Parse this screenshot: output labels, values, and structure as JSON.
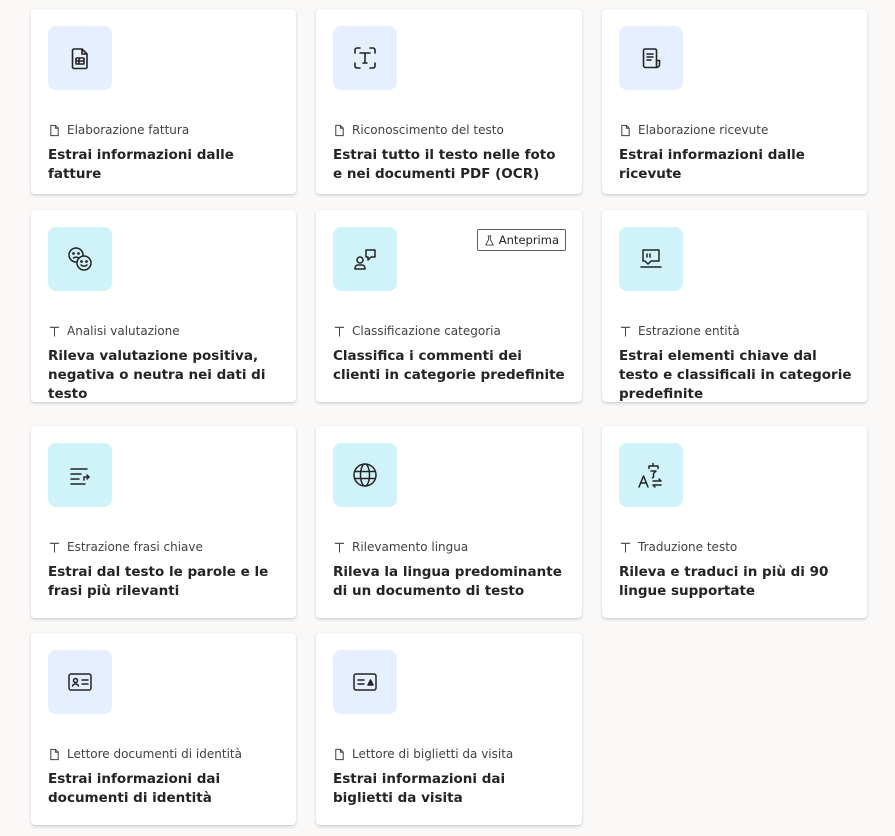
{
  "cards": [
    {
      "category": "Elaborazione fattura",
      "description": "Estrai informazioni dalle fatture",
      "icon": "invoice-icon",
      "type": "document"
    },
    {
      "category": "Riconoscimento del testo",
      "description": "Estrai tutto il testo nelle foto e nei documenti PDF (OCR)",
      "icon": "text-scan-icon",
      "type": "document"
    },
    {
      "category": "Elaborazione ricevute",
      "description": "Estrai informazioni dalle ricevute",
      "icon": "receipt-icon",
      "type": "document"
    },
    {
      "category": "Analisi valutazione",
      "description": "Rileva valutazione positiva, negativa o neutra nei dati di testo",
      "icon": "sentiment-icon",
      "type": "text"
    },
    {
      "category": "Classificazione categoria",
      "description": "Classifica i commenti dei clienti in categorie predefinite",
      "icon": "person-feedback-icon",
      "type": "text",
      "badge": "Anteprima"
    },
    {
      "category": "Estrazione entità",
      "description": "Estrai elementi chiave dal testo e classificali in categorie predefinite",
      "icon": "entity-extraction-icon",
      "type": "text"
    },
    {
      "category": "Estrazione frasi chiave",
      "description": "Estrai dal testo le parole e le frasi più rilevanti",
      "icon": "key-phrase-icon",
      "type": "text"
    },
    {
      "category": "Rilevamento lingua",
      "description": "Rileva la lingua predominante di un documento di testo",
      "icon": "globe-icon",
      "type": "text"
    },
    {
      "category": "Traduzione testo",
      "description": "Rileva e traduci in più di 90 lingue supportate",
      "icon": "translate-icon",
      "type": "text"
    },
    {
      "category": "Lettore documenti di identità",
      "description": "Estrai informazioni dai documenti di identità",
      "icon": "id-card-icon",
      "type": "document"
    },
    {
      "category": "Lettore di biglietti da visita",
      "description": "Estrai informazioni dai biglietti da visita",
      "icon": "business-card-icon",
      "type": "document"
    }
  ],
  "colors": {
    "tile_blue": "#e6efff",
    "tile_cyan": "#cff3f8",
    "background": "#faf9f8",
    "card": "#ffffff"
  }
}
